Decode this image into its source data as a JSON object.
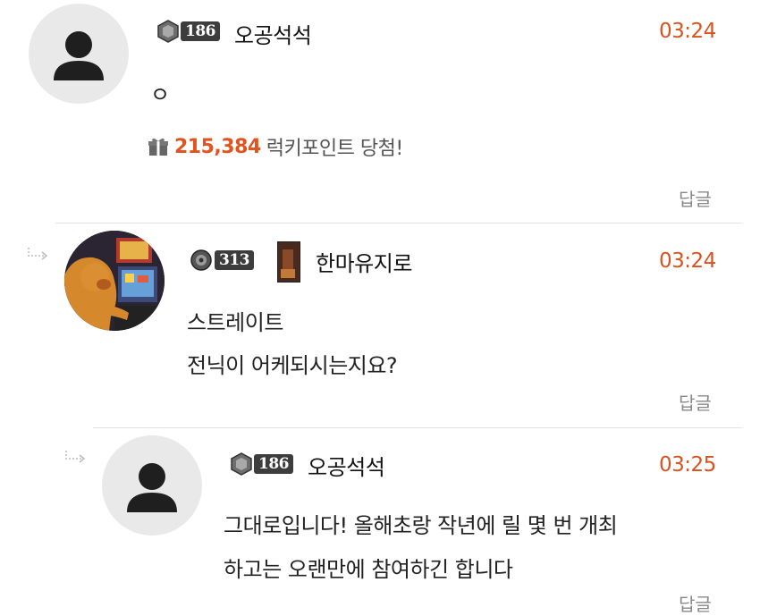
{
  "comments": [
    {
      "level": "186",
      "nickname": "오공석석",
      "time": "03:24",
      "lines": [
        "ㅇ"
      ],
      "lucky_points": "215,384",
      "lucky_suffix": "럭키포인트 당첨!",
      "reply_label": "답글"
    },
    {
      "level": "313",
      "nickname": "한마유지로",
      "time": "03:24",
      "lines": [
        "스트레이트",
        "전닉이 어케되시는지요?"
      ],
      "reply_label": "답글"
    },
    {
      "level": "186",
      "nickname": "오공석석",
      "time": "03:25",
      "lines": [
        "그대로입니다! 올해초랑 작년에 릴 몇 번 개최",
        "하고는 오랜만에 참여하긴 합니다"
      ],
      "reply_label": "답글"
    }
  ],
  "colors": {
    "accent": "#d9531e",
    "muted": "#888888",
    "divider": "#e3e3e3"
  },
  "icons": [
    "user-avatar-icon",
    "level-badge-icon",
    "gift-icon",
    "reply-arrow-icon"
  ]
}
